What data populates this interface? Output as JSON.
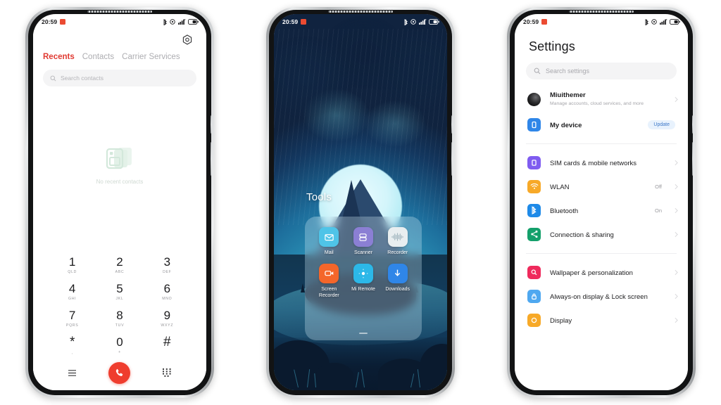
{
  "status_bar": {
    "time": "20:59",
    "icons": [
      "bluetooth-icon",
      "silent-mode-icon",
      "signal-icon",
      "battery-icon"
    ]
  },
  "phone1_dialer": {
    "gear_icon": "gear-icon",
    "tabs": [
      {
        "label": "Recents",
        "active": true
      },
      {
        "label": "Contacts",
        "active": false
      },
      {
        "label": "Carrier Services",
        "active": false
      }
    ],
    "search": {
      "placeholder": "Search contacts",
      "icon": "search-icon"
    },
    "empty_state": {
      "label": "No recent contacts",
      "icon": "contact-cards-icon"
    },
    "keypad": [
      {
        "num": "1",
        "sub": "QLD"
      },
      {
        "num": "2",
        "sub": "ABC"
      },
      {
        "num": "3",
        "sub": "DEF"
      },
      {
        "num": "4",
        "sub": "GHI"
      },
      {
        "num": "5",
        "sub": "JKL"
      },
      {
        "num": "6",
        "sub": "MNO"
      },
      {
        "num": "7",
        "sub": "PQRS"
      },
      {
        "num": "8",
        "sub": "TUV"
      },
      {
        "num": "9",
        "sub": "WXYZ"
      },
      {
        "num": "*",
        "sub": ","
      },
      {
        "num": "0",
        "sub": "+"
      },
      {
        "num": "#",
        "sub": ""
      }
    ],
    "actions": {
      "menu_icon": "menu-icon",
      "call_icon": "call-icon",
      "dialpad_icon": "dialpad-icon"
    },
    "accent_color": "#e03a32",
    "call_button_color": "#ef3d2e"
  },
  "phone2_home": {
    "folder_title": "Tools",
    "apps": [
      {
        "label": "Mail",
        "icon": "mail-icon",
        "color": "#4fc4e8"
      },
      {
        "label": "Scanner",
        "icon": "scanner-icon",
        "color": "#8b7fd4"
      },
      {
        "label": "Recorder",
        "icon": "recorder-icon",
        "color": "#e8eef0"
      },
      {
        "label": "Screen Recorder",
        "icon": "screen-recorder-icon",
        "color": "#f4662a"
      },
      {
        "label": "Mi Remote",
        "icon": "remote-icon",
        "color": "#2cb8e8"
      },
      {
        "label": "Downloads",
        "icon": "download-icon",
        "color": "#2f86e8"
      }
    ]
  },
  "phone3_settings": {
    "title": "Settings",
    "search": {
      "placeholder": "Search settings",
      "icon": "search-icon"
    },
    "account": {
      "name": "Miuithemer",
      "subtitle": "Manage accounts, cloud services, and more",
      "icon": "avatar"
    },
    "device": {
      "label": "My device",
      "badge": "Update",
      "icon": "phone-icon",
      "color": "#2f86e8"
    },
    "groups": [
      {
        "rows": [
          {
            "label": "SIM cards & mobile networks",
            "value": "",
            "icon": "sim-icon",
            "color": "#7f5cf0"
          },
          {
            "label": "WLAN",
            "value": "Off",
            "icon": "wifi-icon",
            "color": "#f7a928"
          },
          {
            "label": "Bluetooth",
            "value": "On",
            "icon": "bluetooth-icon",
            "color": "#1e8ae8"
          },
          {
            "label": "Connection & sharing",
            "value": "",
            "icon": "share-icon",
            "color": "#14a06b"
          }
        ]
      },
      {
        "rows": [
          {
            "label": "Wallpaper & personalization",
            "value": "",
            "icon": "wallpaper-icon",
            "color": "#ef2a5c"
          },
          {
            "label": "Always-on display & Lock screen",
            "value": "",
            "icon": "lock-icon",
            "color": "#4fa8f0"
          },
          {
            "label": "Display",
            "value": "",
            "icon": "display-icon",
            "color": "#f7a928"
          }
        ]
      }
    ]
  }
}
